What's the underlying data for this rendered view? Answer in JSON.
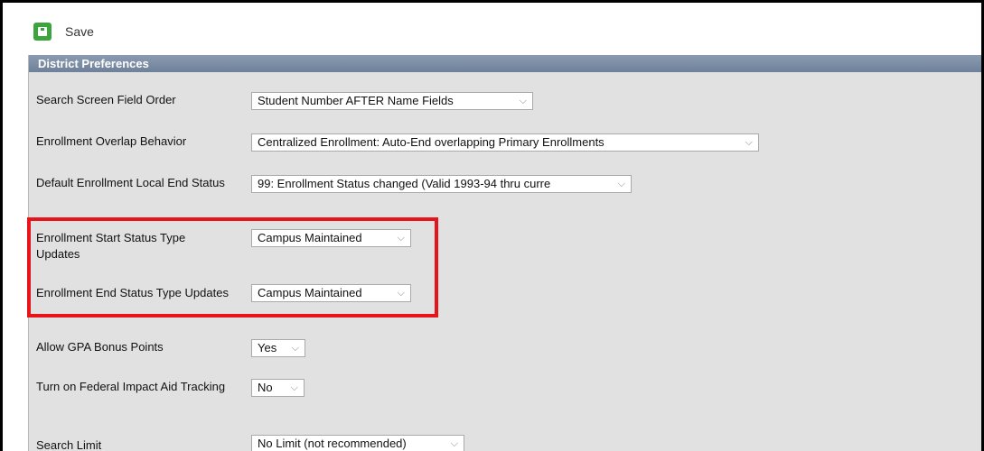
{
  "toolbar": {
    "save_label": "Save"
  },
  "panel": {
    "title": "District Preferences"
  },
  "fields": [
    {
      "label": "Search Screen Field Order",
      "value": "Student Number AFTER Name Fields"
    },
    {
      "label": "Enrollment Overlap Behavior",
      "value": "Centralized Enrollment: Auto-End overlapping Primary Enrollments"
    },
    {
      "label": "Default Enrollment Local End Status",
      "value": "99: Enrollment Status changed (Valid 1993-94 thru curre"
    },
    {
      "label": "Enrollment Start Status Type Updates",
      "value": "Campus Maintained"
    },
    {
      "label": "Enrollment End Status Type Updates",
      "value": "Campus Maintained"
    },
    {
      "label": "Allow GPA Bonus Points",
      "value": "Yes"
    },
    {
      "label": "Turn on Federal Impact Aid Tracking",
      "value": "No"
    },
    {
      "label": "Search Limit",
      "value": "No Limit (not recommended)"
    }
  ],
  "icons": {
    "save": "save-icon",
    "dropdown": "chevron-down-icon"
  },
  "colors": {
    "save_green": "#3da43d",
    "highlight_red": "#e8141c",
    "header_blue": "#7d8fa7",
    "panel_gray": "#e1e1e1"
  }
}
